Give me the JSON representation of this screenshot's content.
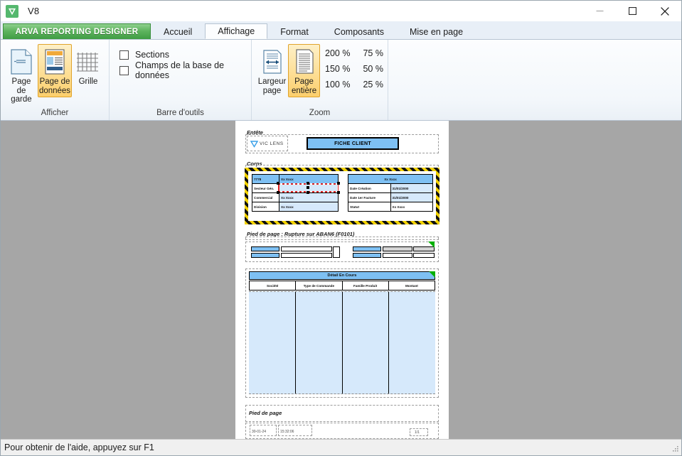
{
  "window": {
    "title": "V8",
    "logo_icon": "v-logo-icon",
    "minimize_icon": "minimize-icon",
    "maximize_icon": "maximize-icon",
    "close_icon": "close-icon"
  },
  "ribbon": {
    "brand_tab": "ARVA REPORTING DESIGNER",
    "tabs": [
      {
        "label": "Accueil",
        "active": false
      },
      {
        "label": "Affichage",
        "active": true
      },
      {
        "label": "Format",
        "active": false
      },
      {
        "label": "Composants",
        "active": false
      },
      {
        "label": "Mise en page",
        "active": false
      }
    ],
    "groups": {
      "afficher": {
        "label": "Afficher",
        "buttons": [
          {
            "label_line1": "Page de",
            "label_line2": "garde",
            "icon": "cover-page-icon",
            "selected": false
          },
          {
            "label_line1": "Page de",
            "label_line2": "données",
            "icon": "data-page-icon",
            "selected": true
          },
          {
            "label_line1": "Grille",
            "label_line2": "",
            "icon": "grid-icon",
            "selected": false
          }
        ]
      },
      "barre_outils": {
        "label": "Barre d'outils",
        "checkboxes": [
          {
            "label": "Sections",
            "checked": false
          },
          {
            "label": "Champs de la base de données",
            "checked": false
          }
        ]
      },
      "zoom": {
        "label": "Zoom",
        "buttons": [
          {
            "label_line1": "Largeur",
            "label_line2": "page",
            "icon": "page-width-icon",
            "selected": false
          },
          {
            "label_line1": "Page",
            "label_line2": "entière",
            "icon": "whole-page-icon",
            "selected": true
          }
        ],
        "levels": [
          "200 %",
          "75 %",
          "150 %",
          "50 %",
          "100 %",
          "25 %"
        ]
      }
    }
  },
  "report": {
    "bands": {
      "entete_label": "Entête",
      "corps_label": "Corps",
      "pied_rupture_label": "Pied de page : Rupture sur ABAN6 (F0101)",
      "pied_label": "Pied de page"
    },
    "logo": {
      "mark": "v-triangle-icon",
      "text": "VIC LENS"
    },
    "title_banner": "FICHE CLIENT",
    "client_table": {
      "id": "7778",
      "name": "Xx Xxxx",
      "rows": [
        {
          "label": "Secteur Géo.",
          "value": "Xx Xxxx"
        },
        {
          "label": "Commercial",
          "value": "Xx Xxxx"
        },
        {
          "label": "Division",
          "value": "Xx Xxxx"
        }
      ]
    },
    "info_table": {
      "header": "Xx Xxxx",
      "rows": [
        {
          "label": "Date Création",
          "value": "31/01/2000"
        },
        {
          "label": "Date 1er Facture",
          "value": "31/01/2000"
        },
        {
          "label": "Statut",
          "value": "Xx Xxxx"
        }
      ]
    },
    "detail_section": {
      "header": "Détail En Cours",
      "columns": [
        "Société",
        "Type de Commande",
        "Famille Produit",
        "Montant"
      ]
    },
    "footer": {
      "date": "30-01-24",
      "time": "15:32:06",
      "page_number": "1/1"
    }
  },
  "statusbar": {
    "hint": "Pour obtenir de l'aide, appuyez sur F1",
    "grip_icon": "resize-grip-icon"
  }
}
